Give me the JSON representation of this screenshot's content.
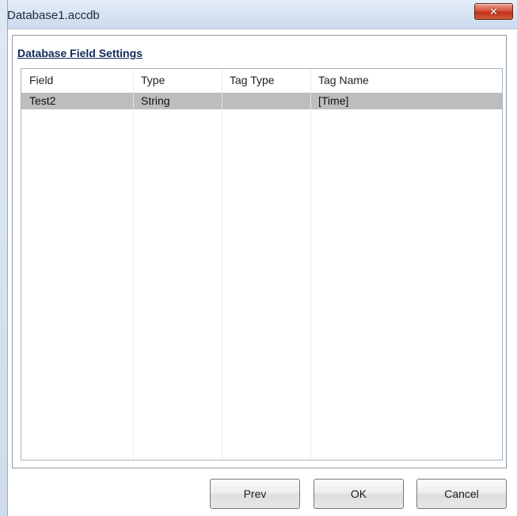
{
  "window": {
    "title": "Database1.accdb",
    "close_glyph": "✕"
  },
  "panel": {
    "section_title": "Database Field Settings"
  },
  "table": {
    "columns": [
      "Field",
      "Type",
      "Tag Type",
      "Tag Name"
    ],
    "rows": [
      {
        "field": "Test2",
        "type": "String",
        "tag_type": "",
        "tag_name": "[Time]"
      }
    ]
  },
  "buttons": {
    "prev": "Prev",
    "ok": "OK",
    "cancel": "Cancel"
  },
  "colors": {
    "titlebar": "#d6e3f2",
    "close": "#c0321a",
    "selected_row": "#bdbdbd",
    "section_title": "#102a5a"
  }
}
